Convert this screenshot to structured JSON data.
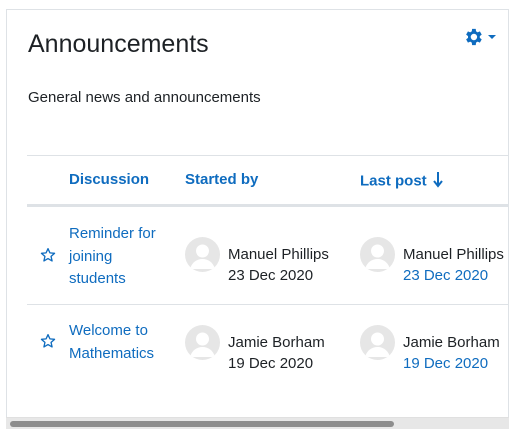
{
  "block": {
    "title": "Announcements",
    "description": "General news and announcements"
  },
  "table": {
    "headers": {
      "discussion": "Discussion",
      "started_by": "Started by",
      "last_post": "Last post"
    },
    "sort": {
      "column": "last_post",
      "direction": "descending"
    },
    "rows": [
      {
        "discussion": "Reminder for joining students",
        "started_by_name": "Manuel Phillips",
        "started_by_date": "23 Dec 2020",
        "last_post_name": "Manuel Phillips",
        "last_post_date": "23 Dec 2020"
      },
      {
        "discussion": "Welcome to Mathematics",
        "started_by_name": "Jamie Borham",
        "started_by_date": "19 Dec 2020",
        "last_post_name": "Jamie Borham",
        "last_post_date": "19 Dec 2020"
      }
    ]
  },
  "icons": {
    "settings": "gear-icon",
    "settings_menu": "caret-down-icon",
    "favourite": "star-outline-icon",
    "sort": "arrow-down-icon",
    "avatar": "user-placeholder-icon"
  },
  "colors": {
    "link": "#0f6cbf",
    "text": "#1d2125",
    "border": "#dee2e6"
  }
}
